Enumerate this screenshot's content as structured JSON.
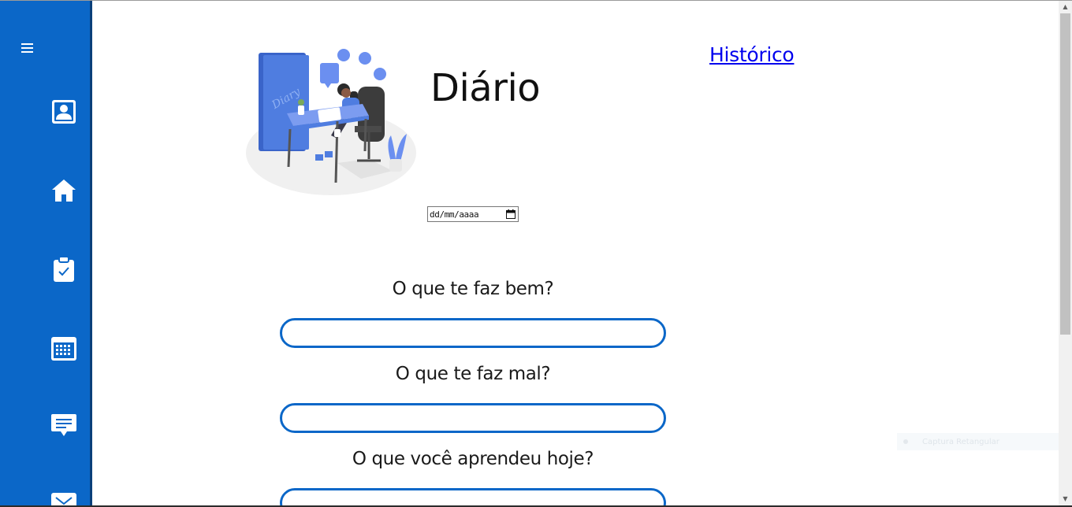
{
  "sidebar": {
    "background_color": "#0b67c8",
    "menu_icon": "hamburger-menu-icon",
    "items": [
      {
        "icon": "profile-icon"
      },
      {
        "icon": "home-icon"
      },
      {
        "icon": "clipboard-check-icon"
      },
      {
        "icon": "calendar-icon"
      },
      {
        "icon": "message-icon"
      },
      {
        "icon": "mail-icon"
      }
    ]
  },
  "header": {
    "title": "Diário",
    "history_link": "Histórico"
  },
  "illustration": {
    "book_text": "Diary"
  },
  "date_input": {
    "placeholder": "dd/mm/aaaa",
    "icon": "calendar-picker-icon"
  },
  "questions": [
    {
      "label": "O que te faz bem?",
      "value": ""
    },
    {
      "label": "O que te faz mal?",
      "value": ""
    },
    {
      "label": "O que você aprendeu hoje?",
      "value": ""
    }
  ],
  "overlay": {
    "toast_text": "Captura Retangular"
  },
  "colors": {
    "accent": "#0b67c8",
    "link": "#0000ee"
  }
}
